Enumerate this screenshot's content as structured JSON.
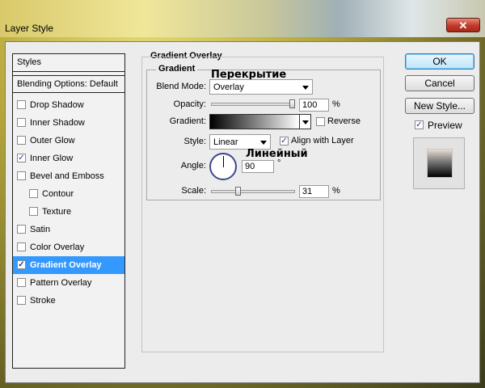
{
  "window": {
    "title": "Layer Style",
    "close_glyph": "✕"
  },
  "styles_panel": {
    "header": "Styles",
    "blending": "Blending Options: Default",
    "items": [
      {
        "label": "Drop Shadow",
        "checked": false,
        "indent": false,
        "selected": false
      },
      {
        "label": "Inner Shadow",
        "checked": false,
        "indent": false,
        "selected": false
      },
      {
        "label": "Outer Glow",
        "checked": false,
        "indent": false,
        "selected": false
      },
      {
        "label": "Inner Glow",
        "checked": true,
        "indent": false,
        "selected": false
      },
      {
        "label": "Bevel and Emboss",
        "checked": false,
        "indent": false,
        "selected": false
      },
      {
        "label": "Contour",
        "checked": false,
        "indent": true,
        "selected": false
      },
      {
        "label": "Texture",
        "checked": false,
        "indent": true,
        "selected": false
      },
      {
        "label": "Satin",
        "checked": false,
        "indent": false,
        "selected": false
      },
      {
        "label": "Color Overlay",
        "checked": false,
        "indent": false,
        "selected": false
      },
      {
        "label": "Gradient Overlay",
        "checked": true,
        "indent": false,
        "selected": true
      },
      {
        "label": "Pattern Overlay",
        "checked": false,
        "indent": false,
        "selected": false
      },
      {
        "label": "Stroke",
        "checked": false,
        "indent": false,
        "selected": false
      }
    ]
  },
  "gradient_overlay": {
    "section_title": "Gradient Overlay",
    "group_title": "Gradient",
    "blend_mode_label": "Blend Mode:",
    "blend_mode_value": "Overlay",
    "blend_mode_annotation": "Перекрытие",
    "opacity_label": "Opacity:",
    "opacity_value": "100",
    "opacity_fraction": 1.0,
    "opacity_unit": "%",
    "gradient_label": "Gradient:",
    "reverse_label": "Reverse",
    "reverse_checked": false,
    "style_label": "Style:",
    "style_value": "Linear",
    "style_annotation": "Линейный",
    "align_label": "Align with Layer",
    "align_checked": true,
    "angle_label": "Angle:",
    "angle_value": "90",
    "angle_unit": "°",
    "scale_label": "Scale:",
    "scale_value": "31",
    "scale_fraction": 0.31,
    "scale_unit": "%"
  },
  "actions": {
    "ok": "OK",
    "cancel": "Cancel",
    "new_style": "New Style...",
    "preview_label": "Preview",
    "preview_checked": true
  }
}
